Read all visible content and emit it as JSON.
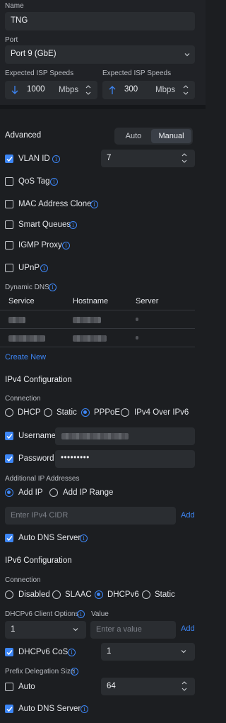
{
  "top": {
    "name_label": "Name",
    "name_value": "TNG",
    "port_label": "Port",
    "port_value": "Port 9 (GbE)",
    "down_label": "Expected ISP Speeds",
    "down_value": "1000",
    "down_unit": "Mbps",
    "up_label": "Expected ISP Speeds",
    "up_value": "300",
    "up_unit": "Mbps"
  },
  "advanced": {
    "title": "Advanced",
    "mode_auto": "Auto",
    "mode_manual": "Manual",
    "mode_selected": "Manual",
    "vlan_label": "VLAN ID",
    "vlan_checked": true,
    "vlan_value": "7",
    "qos_label": "QoS Tag",
    "mac_label": "MAC Address Clone",
    "smartq_label": "Smart Queues",
    "igmp_label": "IGMP Proxy",
    "upnp_label": "UPnP"
  },
  "ddns": {
    "title": "Dynamic DNS",
    "columns": [
      "Service",
      "Hostname",
      "Server"
    ],
    "create_label": "Create New"
  },
  "ipv4": {
    "title": "IPv4 Configuration",
    "connection_label": "Connection",
    "options": [
      "DHCP",
      "Static",
      "PPPoE",
      "IPv4 Over IPv6"
    ],
    "selected": "PPPoE",
    "username_label": "Username",
    "password_label": "Password",
    "password_value": "•••••••••",
    "additional_label": "Additional IP Addresses",
    "add_ip": "Add IP",
    "add_range": "Add IP Range",
    "cidr_placeholder": "Enter IPv4 CIDR",
    "add_link": "Add",
    "auto_dns_label": "Auto DNS Server"
  },
  "ipv6": {
    "title": "IPv6 Configuration",
    "connection_label": "Connection",
    "options": [
      "Disabled",
      "SLAAC",
      "DHCPv6",
      "Static"
    ],
    "selected": "DHCPv6",
    "client_options_label": "DHCPv6 Client Options",
    "value_label": "Value",
    "client_option_value": "1",
    "value_placeholder": "Enter a value",
    "add_link": "Add",
    "cos_label": "DHCPv6 CoS",
    "cos_value": "1",
    "pd_label": "Prefix Delegation Size",
    "pd_auto_label": "Auto",
    "pd_value": "64",
    "auto_dns_label": "Auto DNS Server"
  },
  "colors": {
    "accent": "#3d86f5",
    "background": "#1c1e21",
    "field": "#2a2d31"
  },
  "icons": [
    "info-icon",
    "chevron-down-icon",
    "spinner-icon",
    "arrow-down-icon",
    "arrow-up-icon",
    "checkmark-icon"
  ]
}
